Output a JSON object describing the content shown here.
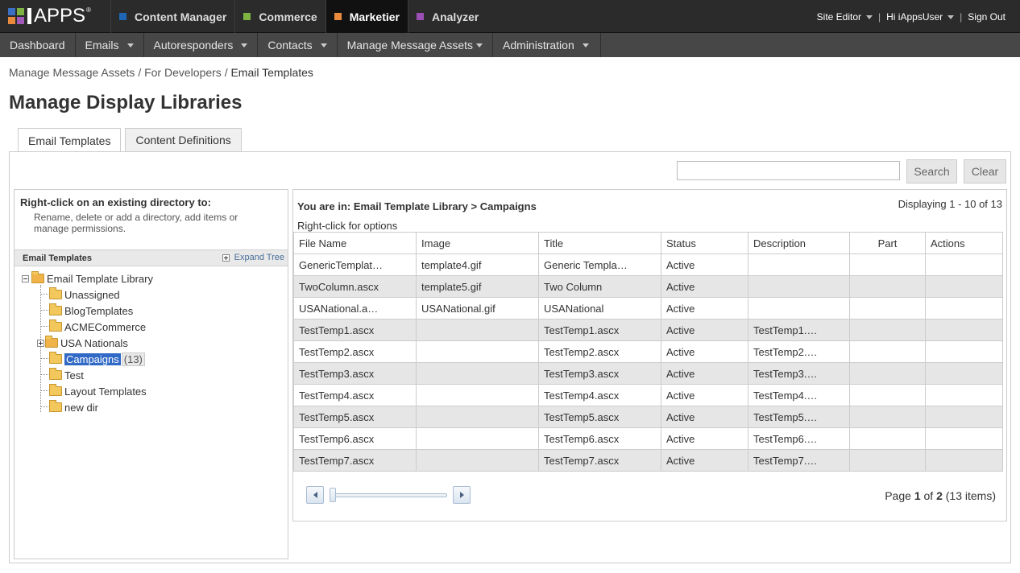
{
  "brand": {
    "logo_text": "APPS",
    "colors": [
      "#3a6fc4",
      "#7cb342",
      "#e98a3c",
      "#a25ab8"
    ]
  },
  "apps": [
    {
      "label": "Content Manager",
      "color": "#1e66b5",
      "active": false
    },
    {
      "label": "Commerce",
      "color": "#7cb342",
      "active": false
    },
    {
      "label": "Marketier",
      "color": "#e98a3c",
      "active": true
    },
    {
      "label": "Analyzer",
      "color": "#9b4fb5",
      "active": false
    }
  ],
  "user": {
    "site_editor": "Site Editor",
    "greeting": "Hi  iAppsUser",
    "sign_out": "Sign Out"
  },
  "nav": [
    {
      "label": "Dashboard",
      "dropdown": false
    },
    {
      "label": "Emails",
      "dropdown": true
    },
    {
      "label": "Autoresponders",
      "dropdown": true
    },
    {
      "label": "Contacts",
      "dropdown": true
    },
    {
      "label": "Manage Message Assets",
      "dropdown": true
    },
    {
      "label": "Administration",
      "dropdown": true
    }
  ],
  "breadcrumb": {
    "items": [
      "Manage Message Assets",
      "For Developers"
    ],
    "separator": "/",
    "current": "Email Templates"
  },
  "page_title": "Manage Display Libraries",
  "tabs": [
    "Email Templates",
    "Content Definitions"
  ],
  "search": {
    "value": "",
    "search_label": "Search",
    "clear_label": "Clear"
  },
  "tree": {
    "hint_title": "Right-click on an existing directory to:",
    "hint_body": "Rename, delete or add a directory, add items or manage permissions.",
    "header": "Email Templates",
    "expand_label": "Expand Tree",
    "root": "Email Template Library",
    "children": [
      "Unassigned",
      "BlogTemplates",
      "ACMECommerce",
      "USA Nationals",
      "Campaigns",
      "Test",
      "Layout Templates",
      "new dir"
    ],
    "selected": "Campaigns",
    "selected_count": "(13)"
  },
  "grid": {
    "location": "You are in: Email Template Library > Campaigns",
    "displaying": "Displaying 1 - 10 of 13",
    "hint": "Right-click for options",
    "columns": [
      "File Name",
      "Image",
      "Title",
      "Status",
      "Description",
      "Part",
      "Actions"
    ],
    "rows": [
      [
        "GenericTemplat…",
        "template4.gif",
        "Generic Templa…",
        "Active",
        "",
        "",
        ""
      ],
      [
        "TwoColumn.ascx",
        "template5.gif",
        "Two Column",
        "Active",
        "",
        "",
        ""
      ],
      [
        "USANational.a…",
        "USANational.gif",
        "USANational",
        "Active",
        "",
        "",
        ""
      ],
      [
        "TestTemp1.ascx",
        "",
        "TestTemp1.ascx",
        "Active",
        "TestTemp1.…",
        "",
        ""
      ],
      [
        "TestTemp2.ascx",
        "",
        "TestTemp2.ascx",
        "Active",
        "TestTemp2.…",
        "",
        ""
      ],
      [
        "TestTemp3.ascx",
        "",
        "TestTemp3.ascx",
        "Active",
        "TestTemp3.…",
        "",
        ""
      ],
      [
        "TestTemp4.ascx",
        "",
        "TestTemp4.ascx",
        "Active",
        "TestTemp4.…",
        "",
        ""
      ],
      [
        "TestTemp5.ascx",
        "",
        "TestTemp5.ascx",
        "Active",
        "TestTemp5.…",
        "",
        ""
      ],
      [
        "TestTemp6.ascx",
        "",
        "TestTemp6.ascx",
        "Active",
        "TestTemp6.…",
        "",
        ""
      ],
      [
        "TestTemp7.ascx",
        "",
        "TestTemp7.ascx",
        "Active",
        "TestTemp7.…",
        "",
        ""
      ]
    ],
    "pager": {
      "page_label": "Page",
      "page": "1",
      "of_label": "of",
      "total_pages": "2",
      "items": "(13 items)"
    }
  }
}
